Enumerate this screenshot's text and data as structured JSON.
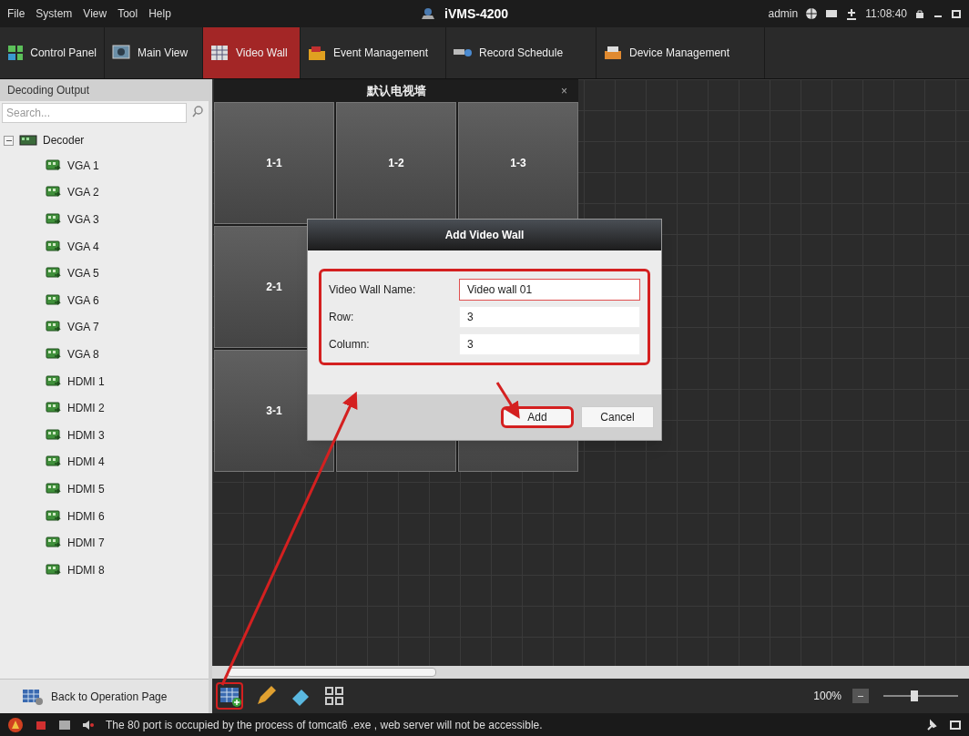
{
  "menu": [
    "File",
    "System",
    "View",
    "Tool",
    "Help"
  ],
  "app_title": "iVMS-4200",
  "user": "admin",
  "time": "11:08:40",
  "tabs": [
    {
      "label": "Control Panel",
      "selected": false
    },
    {
      "label": "Main View",
      "selected": false
    },
    {
      "label": "Video Wall",
      "selected": true
    },
    {
      "label": "Event Management",
      "selected": false
    },
    {
      "label": "Record Schedule",
      "selected": false
    },
    {
      "label": "Device Management",
      "selected": false
    }
  ],
  "sidebar": {
    "title": "Decoding Output",
    "search": {
      "placeholder": "Search..."
    },
    "tree": [
      {
        "label": "Decoder",
        "expanded": true,
        "children": [
          {
            "label": "VGA 1"
          },
          {
            "label": "VGA 2"
          },
          {
            "label": "VGA 3"
          },
          {
            "label": "VGA 4"
          },
          {
            "label": "VGA 5"
          },
          {
            "label": "VGA 6"
          },
          {
            "label": "VGA 7"
          },
          {
            "label": "VGA 8"
          },
          {
            "label": "HDMI 1"
          },
          {
            "label": "HDMI 2"
          },
          {
            "label": "HDMI 3"
          },
          {
            "label": "HDMI 4"
          },
          {
            "label": "HDMI 5"
          },
          {
            "label": "HDMI 6"
          },
          {
            "label": "HDMI 7"
          },
          {
            "label": "HDMI 8"
          }
        ]
      }
    ],
    "back_button": "Back to Operation Page"
  },
  "video_wall": {
    "title": "默认电视墙",
    "close": "×",
    "rows": [
      [
        "1-1",
        "1-2",
        "1-3"
      ],
      [
        "2-1"
      ],
      [
        "3-1"
      ]
    ]
  },
  "dialog": {
    "title": "Add Video Wall",
    "fields": [
      {
        "label": "Video Wall Name:",
        "value": "Video wall 01",
        "focused": true
      },
      {
        "label": "Row:",
        "value": "3",
        "focused": false
      },
      {
        "label": "Column:",
        "value": "3",
        "focused": false
      }
    ],
    "buttons": [
      "Add",
      "Cancel"
    ]
  },
  "zoom": {
    "reading": "100%",
    "level": 0.42
  },
  "status_bar": {
    "message": "The 80 port is occupied by the process of tomcat6 .exe , web server will not be accessible."
  }
}
